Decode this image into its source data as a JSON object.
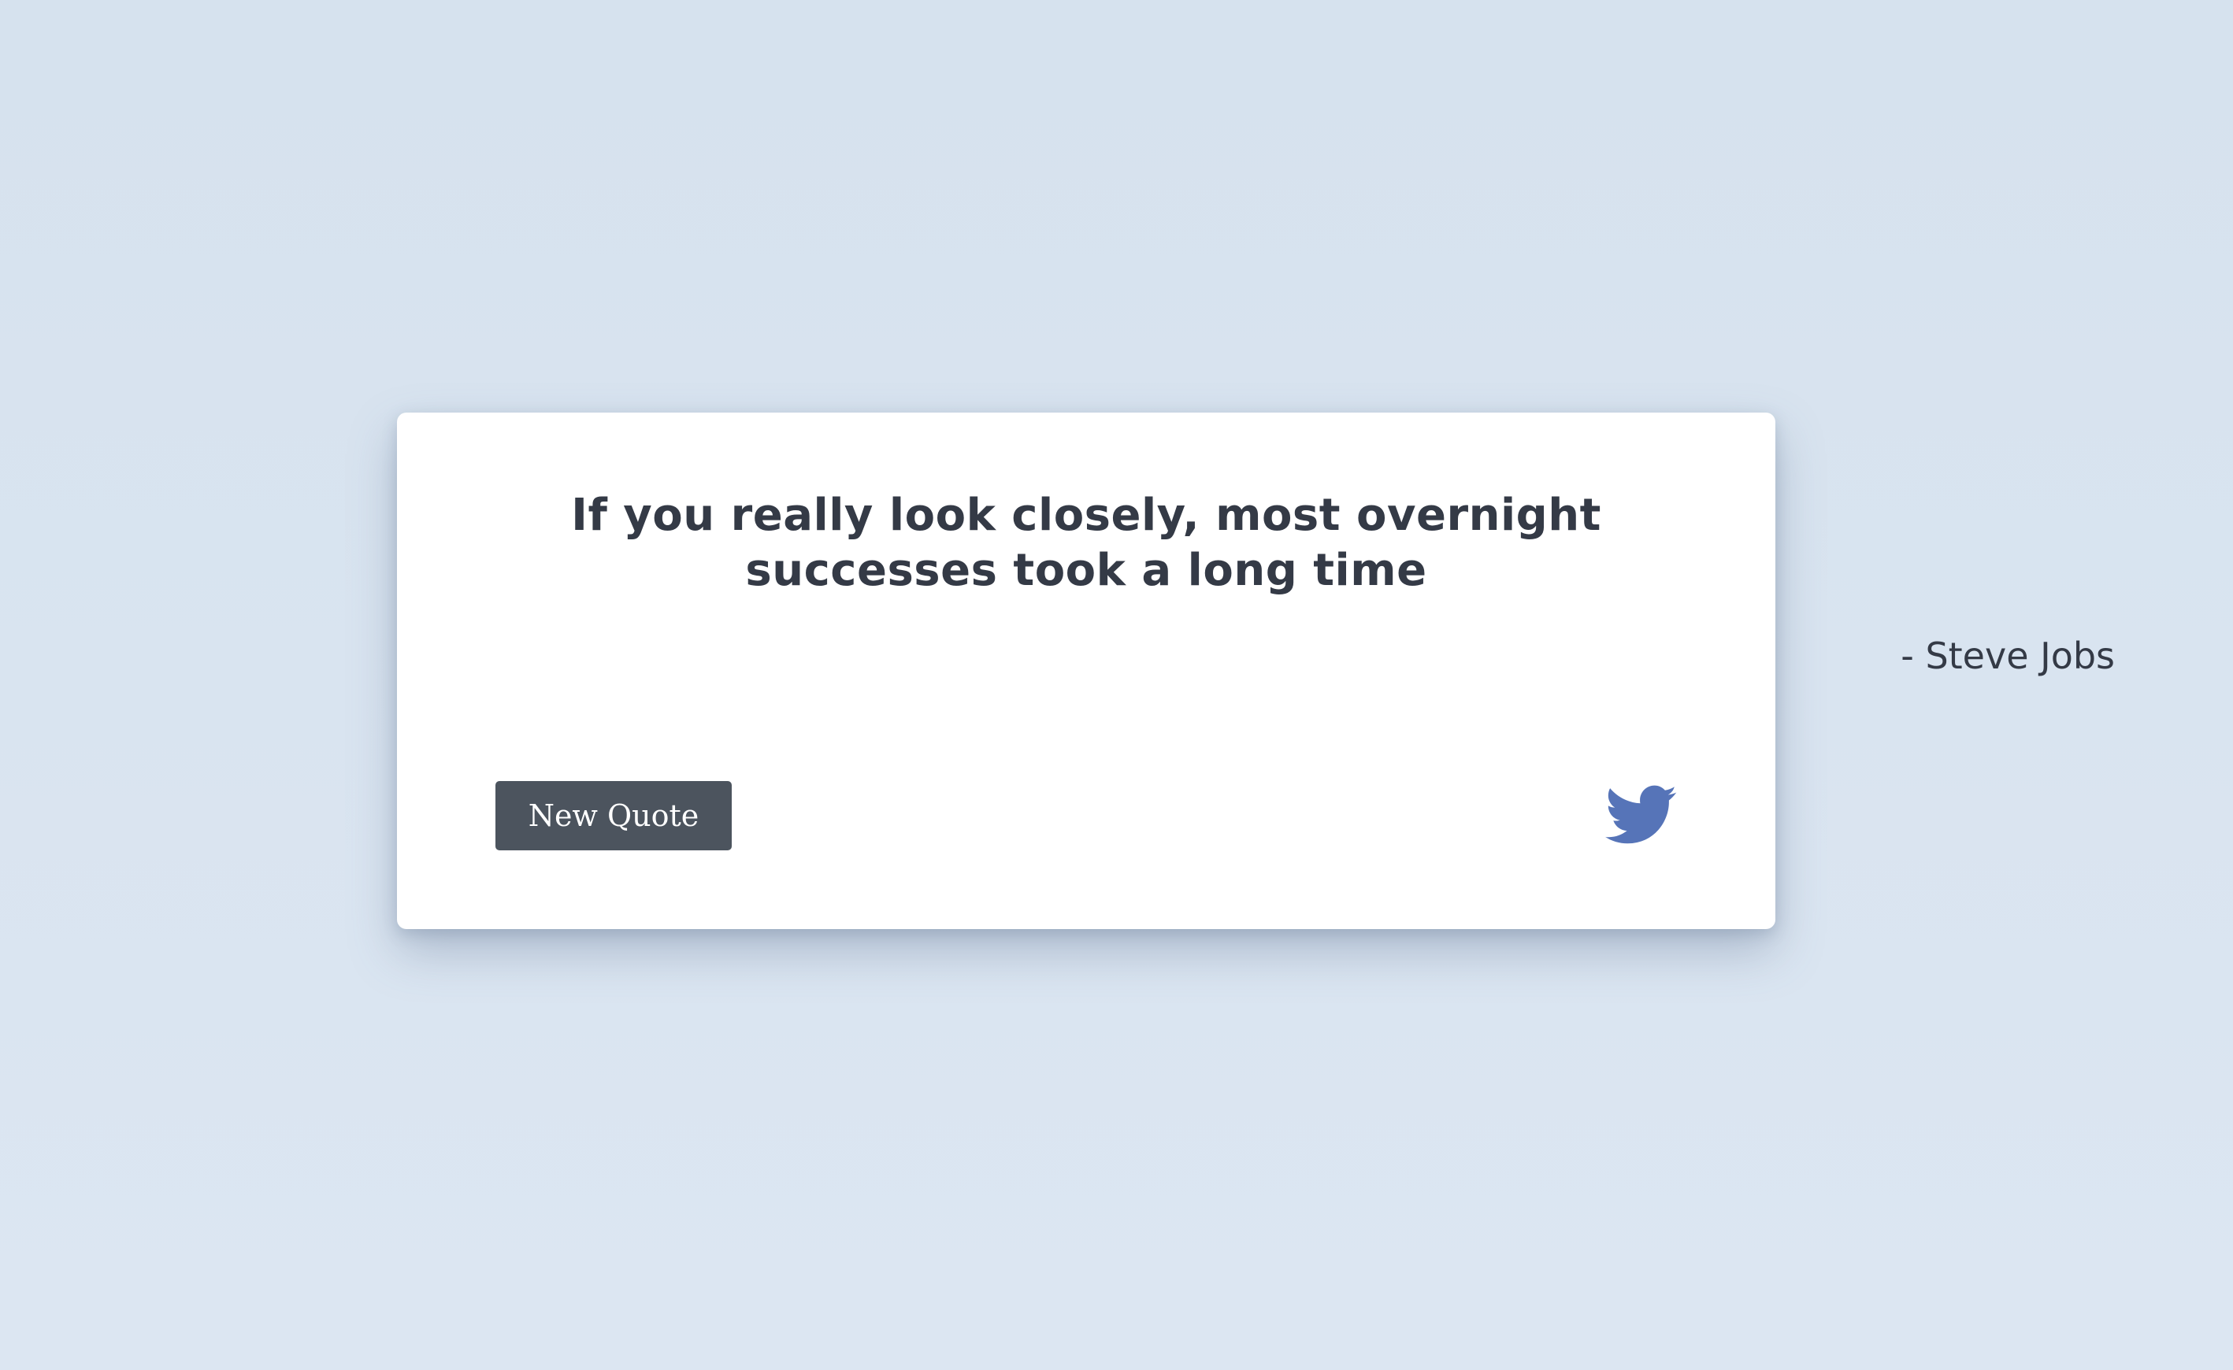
{
  "quote": {
    "text": "If you really look closely, most overnight successes took a long time",
    "author": "- Steve Jobs"
  },
  "actions": {
    "new_quote_label": "New Quote",
    "tweet_icon": "twitter-icon"
  },
  "colors": {
    "background": "#d9e4f0",
    "card": "#ffffff",
    "text": "#343a46",
    "button": "#4c545e",
    "twitter": "#5674b8"
  }
}
